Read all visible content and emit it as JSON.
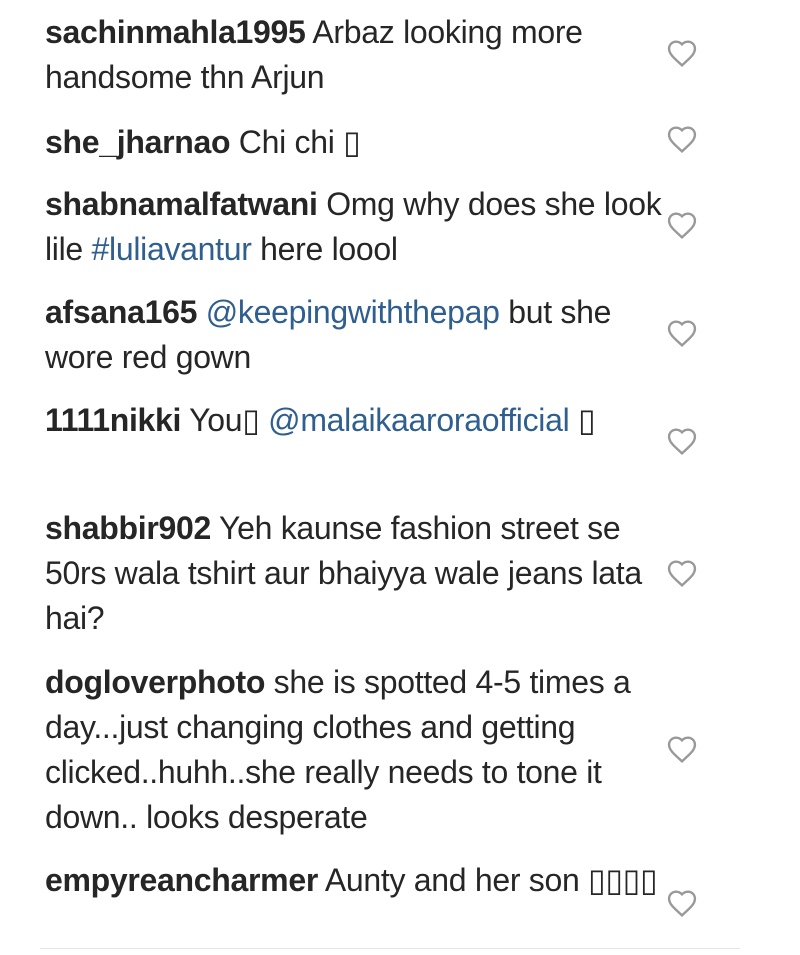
{
  "comments": [
    {
      "username": "sachinmahla1995",
      "parts": [
        " Arbaz looking more handsome thn Arjun"
      ]
    },
    {
      "username": "she_jharnao",
      "parts": [
        " Chi chi ▯"
      ]
    },
    {
      "username": "shabnamalfatwani",
      "parts": [
        " Omg why does she look lile ",
        "#luliavantur",
        " here loool"
      ]
    },
    {
      "username": "afsana165",
      "parts": [
        " ",
        "@keepingwiththepap",
        " but she wore red gown"
      ]
    },
    {
      "username": "1111nikki",
      "parts": [
        " You▯ ",
        "@malaikaaroraofficial",
        " ▯"
      ]
    },
    {
      "username": "shabbir902",
      "parts": [
        " Yeh kaunse fashion street se 50rs wala tshirt aur bhaiyya wale jeans lata hai?"
      ]
    },
    {
      "username": "dogloverphoto",
      "parts": [
        " she is spotted 4-5 times a day...just changing clothes and getting clicked..huhh..she really needs to tone it down.. looks desperate"
      ]
    },
    {
      "username": "empyreancharmer",
      "parts": [
        " Aunty and her son ▯▯▯▯"
      ]
    }
  ],
  "icons": {
    "like": "heart-outline-icon"
  },
  "colors": {
    "text": "#262626",
    "link": "#2f5f8f",
    "icon": "#999999"
  }
}
